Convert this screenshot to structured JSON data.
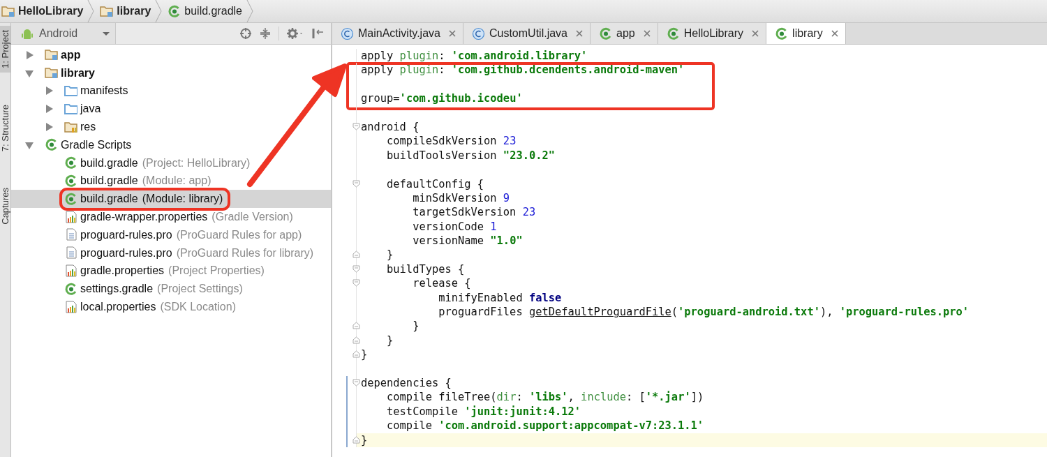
{
  "breadcrumbs": [
    {
      "label": "HelloLibrary",
      "kind": "folder"
    },
    {
      "label": "library",
      "kind": "folder"
    },
    {
      "label": "build.gradle",
      "kind": "gradle"
    }
  ],
  "tool_strip": [
    {
      "label": "1: Project",
      "selected": true
    },
    {
      "label": "7: Structure",
      "selected": false
    },
    {
      "label": "Captures",
      "selected": false
    }
  ],
  "project_panel": {
    "view": "Android",
    "tree": [
      {
        "label": "app",
        "kind": "module",
        "expanded": false,
        "selected": false
      },
      {
        "label": "library",
        "kind": "module",
        "expanded": true,
        "selected": false,
        "children": [
          {
            "label": "manifests",
            "kind": "folder",
            "expanded": false,
            "selected": false
          },
          {
            "label": "java",
            "kind": "folder",
            "expanded": false,
            "selected": false
          },
          {
            "label": "res",
            "kind": "res",
            "expanded": false,
            "selected": false
          }
        ]
      },
      {
        "label": "Gradle Scripts",
        "kind": "gradle",
        "expanded": true,
        "selected": false,
        "children": [
          {
            "label": "build.gradle",
            "hint": "(Project: HelloLibrary)",
            "kind": "gradle",
            "selected": false
          },
          {
            "label": "build.gradle",
            "hint": "(Module: app)",
            "kind": "gradle",
            "selected": false
          },
          {
            "label": "build.gradle",
            "hint": "(Module: library)",
            "kind": "gradle",
            "selected": true,
            "annotated": true
          },
          {
            "label": "gradle-wrapper.properties",
            "hint": "(Gradle Version)",
            "kind": "properties",
            "selected": false
          },
          {
            "label": "proguard-rules.pro",
            "hint": "(ProGuard Rules for app)",
            "kind": "file",
            "selected": false
          },
          {
            "label": "proguard-rules.pro",
            "hint": "(ProGuard Rules for library)",
            "kind": "file",
            "selected": false
          },
          {
            "label": "gradle.properties",
            "hint": "(Project Properties)",
            "kind": "properties",
            "selected": false
          },
          {
            "label": "settings.gradle",
            "hint": "(Project Settings)",
            "kind": "gradle",
            "selected": false
          },
          {
            "label": "local.properties",
            "hint": "(SDK Location)",
            "kind": "properties",
            "selected": false
          }
        ]
      }
    ]
  },
  "editor_tabs": [
    {
      "label": "MainActivity.java",
      "kind": "class",
      "selected": false
    },
    {
      "label": "CustomUtil.java",
      "kind": "class",
      "selected": false
    },
    {
      "label": "app",
      "kind": "gradle",
      "selected": false
    },
    {
      "label": "HelloLibrary",
      "kind": "gradle",
      "selected": false
    },
    {
      "label": "library",
      "kind": "gradle",
      "selected": true
    }
  ],
  "code": [
    {
      "kind": "code",
      "tokens": [
        {
          "t": "apply ",
          "kind": "plain"
        },
        {
          "t": "plugin",
          "kind": "keyword"
        },
        {
          "t": ": ",
          "kind": "plain"
        },
        {
          "t": "'com.android.library'",
          "kind": "string"
        }
      ]
    },
    {
      "kind": "code",
      "annotated": true,
      "tokens": [
        {
          "t": "apply ",
          "kind": "plain"
        },
        {
          "t": "plugin",
          "kind": "keyword"
        },
        {
          "t": ": ",
          "kind": "plain"
        },
        {
          "t": "'com.github.dcendents.android-maven'",
          "kind": "string"
        }
      ]
    },
    {
      "kind": "blank",
      "annotated": true
    },
    {
      "kind": "code",
      "annotated": true,
      "tokens": [
        {
          "t": "group=",
          "kind": "plain"
        },
        {
          "t": "'com.github.icodeu'",
          "kind": "string"
        }
      ]
    },
    {
      "kind": "blank"
    },
    {
      "kind": "code",
      "fold_start": true,
      "tokens": [
        {
          "t": "android {",
          "kind": "plain"
        }
      ]
    },
    {
      "kind": "code",
      "tokens": [
        {
          "t": "    compileSdkVersion ",
          "kind": "plain"
        },
        {
          "t": "23",
          "kind": "number"
        }
      ]
    },
    {
      "kind": "code",
      "tokens": [
        {
          "t": "    buildToolsVersion ",
          "kind": "plain"
        },
        {
          "t": "\"23.0.2\"",
          "kind": "string"
        }
      ]
    },
    {
      "kind": "blank"
    },
    {
      "kind": "code",
      "fold_start": true,
      "tokens": [
        {
          "t": "    defaultConfig {",
          "kind": "plain"
        }
      ]
    },
    {
      "kind": "code",
      "tokens": [
        {
          "t": "        minSdkVersion ",
          "kind": "plain"
        },
        {
          "t": "9",
          "kind": "number"
        }
      ]
    },
    {
      "kind": "code",
      "tokens": [
        {
          "t": "        targetSdkVersion ",
          "kind": "plain"
        },
        {
          "t": "23",
          "kind": "number"
        }
      ]
    },
    {
      "kind": "code",
      "tokens": [
        {
          "t": "        versionCode ",
          "kind": "plain"
        },
        {
          "t": "1",
          "kind": "number"
        }
      ]
    },
    {
      "kind": "code",
      "tokens": [
        {
          "t": "        versionName ",
          "kind": "plain"
        },
        {
          "t": "\"1.0\"",
          "kind": "string"
        }
      ]
    },
    {
      "kind": "code",
      "fold_end": true,
      "tokens": [
        {
          "t": "    }",
          "kind": "plain"
        }
      ]
    },
    {
      "kind": "code",
      "fold_start": true,
      "tokens": [
        {
          "t": "    buildTypes {",
          "kind": "plain"
        }
      ]
    },
    {
      "kind": "code",
      "fold_start": true,
      "tokens": [
        {
          "t": "        release {",
          "kind": "plain"
        }
      ]
    },
    {
      "kind": "code",
      "tokens": [
        {
          "t": "            minifyEnabled ",
          "kind": "plain"
        },
        {
          "t": "false",
          "kind": "bool"
        }
      ]
    },
    {
      "kind": "code",
      "tokens": [
        {
          "t": "            proguardFiles ",
          "kind": "plain"
        },
        {
          "t": "getDefaultProguardFile",
          "kind": "call"
        },
        {
          "t": "(",
          "kind": "plain"
        },
        {
          "t": "'proguard-android.txt'",
          "kind": "string"
        },
        {
          "t": "), ",
          "kind": "plain"
        },
        {
          "t": "'proguard-rules.pro'",
          "kind": "string"
        }
      ]
    },
    {
      "kind": "code",
      "fold_end": true,
      "tokens": [
        {
          "t": "        }",
          "kind": "plain"
        }
      ]
    },
    {
      "kind": "code",
      "fold_end": true,
      "tokens": [
        {
          "t": "    }",
          "kind": "plain"
        }
      ]
    },
    {
      "kind": "code",
      "fold_end": true,
      "tokens": [
        {
          "t": "}",
          "kind": "plain"
        }
      ]
    },
    {
      "kind": "blank"
    },
    {
      "kind": "code",
      "fold_start": true,
      "changed": true,
      "tokens": [
        {
          "t": "dependencies {",
          "kind": "plain"
        }
      ]
    },
    {
      "kind": "code",
      "changed": true,
      "tokens": [
        {
          "t": "    compile fileTree(",
          "kind": "plain"
        },
        {
          "t": "dir",
          "kind": "keyword"
        },
        {
          "t": ": ",
          "kind": "plain"
        },
        {
          "t": "'libs'",
          "kind": "string"
        },
        {
          "t": ", ",
          "kind": "plain"
        },
        {
          "t": "include",
          "kind": "keyword"
        },
        {
          "t": ": [",
          "kind": "plain"
        },
        {
          "t": "'*.jar'",
          "kind": "string"
        },
        {
          "t": "])",
          "kind": "plain"
        }
      ]
    },
    {
      "kind": "code",
      "changed": true,
      "tokens": [
        {
          "t": "    testCompile ",
          "kind": "plain"
        },
        {
          "t": "'junit:junit:4.12'",
          "kind": "string"
        }
      ]
    },
    {
      "kind": "code",
      "changed": true,
      "tokens": [
        {
          "t": "    compile ",
          "kind": "plain"
        },
        {
          "t": "'com.android.support:appcompat-v7:23.1.1'",
          "kind": "string"
        }
      ]
    },
    {
      "kind": "code",
      "fold_end": true,
      "changed": true,
      "current": true,
      "tokens": [
        {
          "t": "}",
          "kind": "plain"
        }
      ]
    }
  ]
}
